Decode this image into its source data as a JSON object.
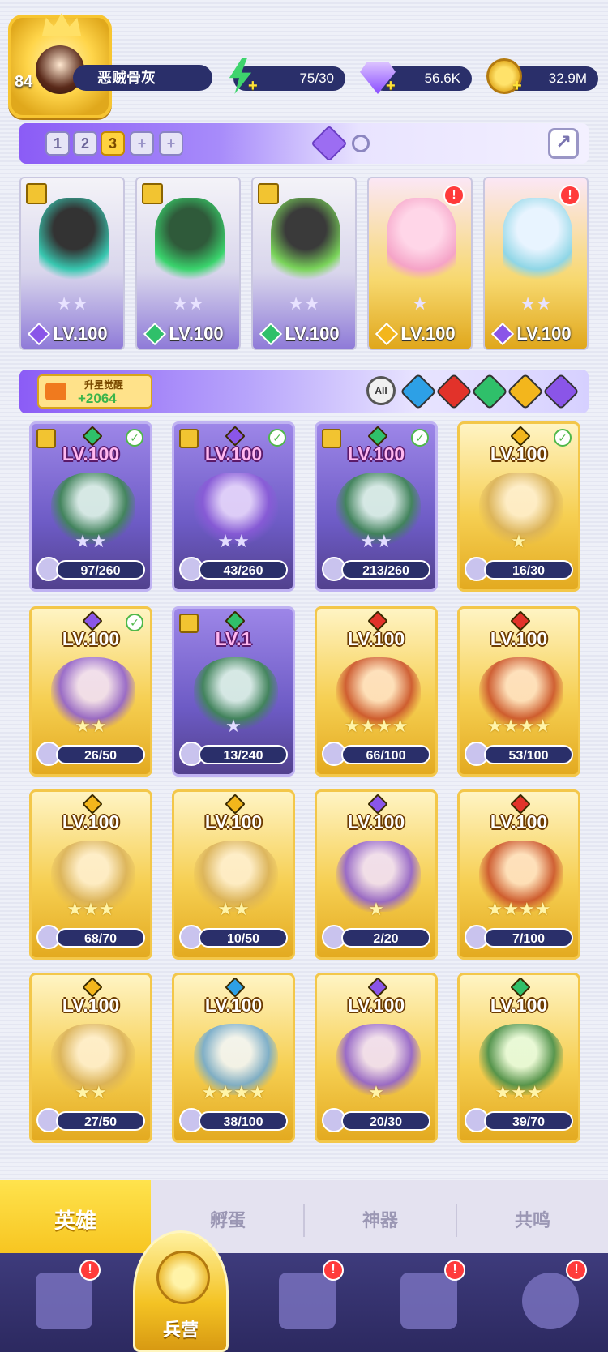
{
  "player": {
    "level": "84",
    "name": "恶贼骨灰"
  },
  "resources": {
    "energy": "75/30",
    "gems": "56.6K",
    "coins": "32.9M"
  },
  "team_tabs": [
    "1",
    "2",
    "3",
    "+",
    "+"
  ],
  "active_team_tab": "3",
  "team_heroes": [
    {
      "level": "LV.100",
      "stars": "★★",
      "element": "purple",
      "bg": "purple"
    },
    {
      "level": "LV.100",
      "stars": "★★",
      "element": "green",
      "bg": "purple"
    },
    {
      "level": "LV.100",
      "stars": "★★",
      "element": "green",
      "bg": "purple"
    },
    {
      "level": "LV.100",
      "stars": "★",
      "element": "gold",
      "bg": "gold",
      "alert": "!"
    },
    {
      "level": "LV.100",
      "stars": "★★",
      "element": "purple",
      "bg": "gold",
      "alert": "!"
    }
  ],
  "awakening": {
    "label": "升星觉醒",
    "value": "+2064"
  },
  "filter": {
    "all_label": "All",
    "elements": [
      "blue",
      "red",
      "green",
      "gold",
      "purple"
    ]
  },
  "heroes": [
    {
      "level": "LV.100",
      "progress": "97/260",
      "stars": "★★",
      "element": "green",
      "card": "purple",
      "check": true,
      "badge": true
    },
    {
      "level": "LV.100",
      "progress": "43/260",
      "stars": "★★",
      "element": "purple",
      "card": "purple",
      "check": true,
      "badge": true
    },
    {
      "level": "LV.100",
      "progress": "213/260",
      "stars": "★★",
      "element": "green",
      "card": "purple",
      "check": true,
      "badge": true
    },
    {
      "level": "LV.100",
      "progress": "16/30",
      "stars": "★",
      "element": "gold",
      "card": "gold",
      "check": true
    },
    {
      "level": "LV.100",
      "progress": "26/50",
      "stars": "★★",
      "element": "purple",
      "card": "gold",
      "check": true
    },
    {
      "level": "LV.1",
      "progress": "13/240",
      "stars": "★",
      "element": "green",
      "card": "purple",
      "badge": true
    },
    {
      "level": "LV.100",
      "progress": "66/100",
      "stars": "★★★★",
      "element": "red",
      "card": "gold"
    },
    {
      "level": "LV.100",
      "progress": "53/100",
      "stars": "★★★★",
      "element": "red",
      "card": "gold"
    },
    {
      "level": "LV.100",
      "progress": "68/70",
      "stars": "★★★",
      "element": "gold",
      "card": "gold"
    },
    {
      "level": "LV.100",
      "progress": "10/50",
      "stars": "★★",
      "element": "gold",
      "card": "gold"
    },
    {
      "level": "LV.100",
      "progress": "2/20",
      "stars": "★",
      "element": "purple",
      "card": "gold"
    },
    {
      "level": "LV.100",
      "progress": "7/100",
      "stars": "★★★★",
      "element": "red",
      "card": "gold"
    },
    {
      "level": "LV.100",
      "progress": "27/50",
      "stars": "★★",
      "element": "gold",
      "card": "gold"
    },
    {
      "level": "LV.100",
      "progress": "38/100",
      "stars": "★★★★",
      "element": "blue",
      "card": "gold"
    },
    {
      "level": "LV.100",
      "progress": "20/30",
      "stars": "★",
      "element": "purple",
      "card": "gold"
    },
    {
      "level": "LV.100",
      "progress": "39/70",
      "stars": "★★★",
      "element": "green",
      "card": "gold"
    }
  ],
  "subtabs": [
    "英雄",
    "孵蛋",
    "神器",
    "共鸣"
  ],
  "active_subtab": "英雄",
  "nav": {
    "center_label": "兵营",
    "alerts": [
      "!",
      "!",
      "!",
      "!"
    ]
  }
}
